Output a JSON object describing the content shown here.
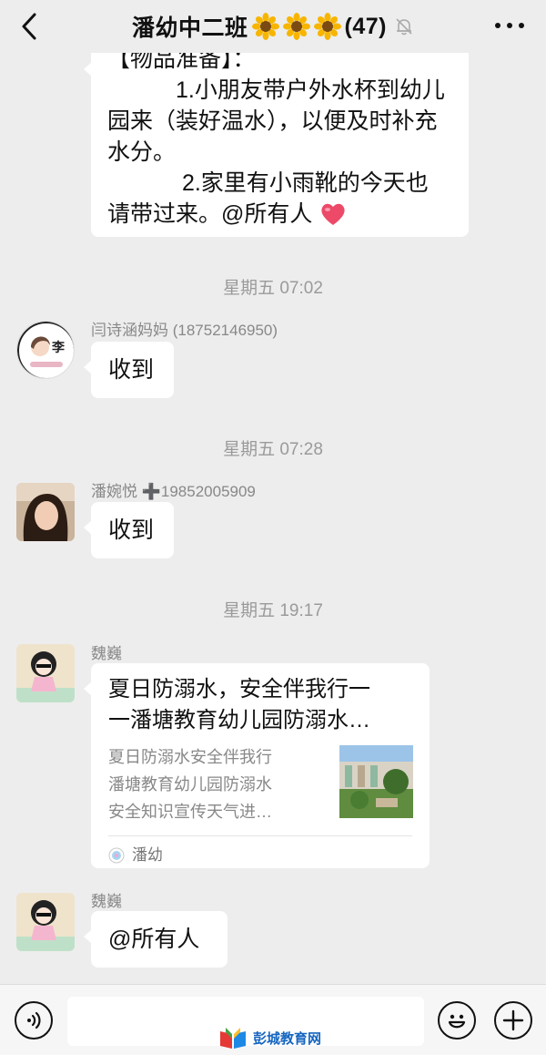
{
  "header": {
    "title": "潘幼中二班",
    "member_count": "(47)",
    "title_icons": [
      "sunflower-emoji",
      "sunflower-emoji",
      "sunflower-emoji"
    ],
    "back_icon": "chevron-left-icon",
    "mute_icon": "bell-muted-icon",
    "more_icon": "more-dots-icon"
  },
  "messages": {
    "m0": {
      "lines": [
        "【物品准备】：",
        "　　　1.小朋友带户外水杯到幼儿",
        "园来（装好温水），以便及时补充",
        "水分。",
        "　　　 2.家里有小雨靴的今天也",
        "请带过来。@所有人"
      ],
      "emoji": "red-heart-emoji"
    },
    "t1": "星期五 07:02",
    "m1": {
      "sender": "闫诗涵妈妈 (18752146950)",
      "text": "收到",
      "avatar_text": "李"
    },
    "t2": "星期五 07:28",
    "m2": {
      "sender": "潘婉悦 ➕19852005909",
      "text": "收到"
    },
    "t3": "星期五 19:17",
    "m3": {
      "sender": "魏巍",
      "card_title_lines": [
        "夏日防溺水，安全伴我行一",
        "一潘塘教育幼儿园防溺水…"
      ],
      "card_desc_lines": [
        "夏日防溺水安全伴我行",
        "潘塘教育幼儿园防溺水",
        "安全知识宣传天气进…"
      ],
      "card_source": "潘幼"
    },
    "m4": {
      "sender": "魏巍",
      "text": "@所有人"
    }
  },
  "input_bar": {
    "voice_icon": "voice-icon",
    "emoji_icon": "smiley-icon",
    "plus_icon": "plus-icon"
  },
  "watermark": {
    "text": "彭城教育网"
  },
  "colors": {
    "background": "#ededed",
    "bubble": "#ffffff",
    "meta_text": "#9a9a9a"
  }
}
